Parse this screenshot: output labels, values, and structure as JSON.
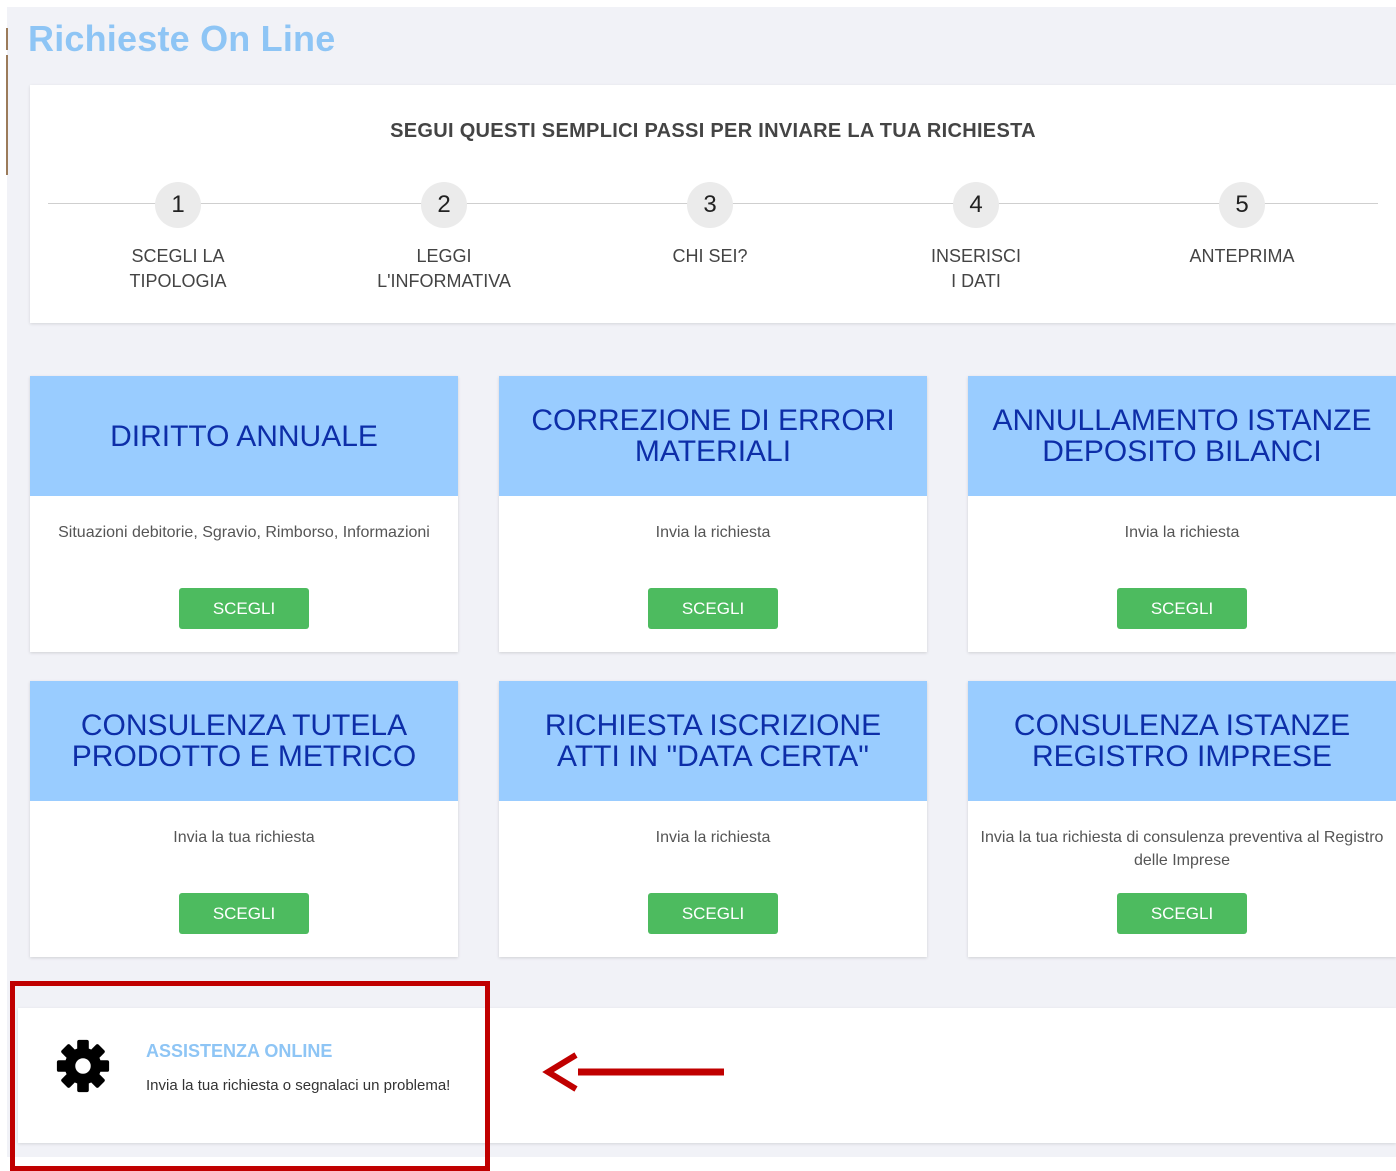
{
  "page": {
    "title": "Richieste On Line"
  },
  "steps": {
    "heading": "SEGUI QUESTI SEMPLICI PASSI PER INVIARE LA TUA RICHIESTA",
    "items": [
      {
        "number": "1",
        "label": "SCEGLI LA\nTIPOLOGIA"
      },
      {
        "number": "2",
        "label": "LEGGI\nL'INFORMATIVA"
      },
      {
        "number": "3",
        "label": "CHI SEI?"
      },
      {
        "number": "4",
        "label": "INSERISCI\nI DATI"
      },
      {
        "number": "5",
        "label": "ANTEPRIMA"
      }
    ]
  },
  "cards": [
    {
      "title": "DIRITTO ANNUALE",
      "description": "Situazioni debitorie, Sgravio, Rimborso, Informazioni",
      "button": "SCEGLI"
    },
    {
      "title": "CORREZIONE DI ERRORI\nMATERIALI",
      "description": "Invia la richiesta",
      "button": "SCEGLI"
    },
    {
      "title": "ANNULLAMENTO ISTANZE\nDEPOSITO BILANCI",
      "description": "Invia la richiesta",
      "button": "SCEGLI"
    },
    {
      "title": "CONSULENZA TUTELA\nPRODOTTO E METRICO",
      "description": "Invia la tua richiesta",
      "button": "SCEGLI"
    },
    {
      "title": "RICHIESTA ISCRIZIONE\nATTI IN \"DATA CERTA\"",
      "description": "Invia la richiesta",
      "button": "SCEGLI"
    },
    {
      "title": "CONSULENZA ISTANZE\nREGISTRO IMPRESE",
      "description": "Invia la tua richiesta di consulenza preventiva al Registro delle Imprese",
      "button": "SCEGLI"
    }
  ],
  "assistance": {
    "title": "ASSISTENZA ONLINE",
    "description": "Invia la tua richiesta o segnalaci un problema!",
    "icon": "gear-icon"
  },
  "colors": {
    "accent_light_blue": "#8ec5f5",
    "card_header_bg": "#99ccff",
    "card_title": "#0d2ea8",
    "button_green": "#4dbb5f",
    "highlight_red": "#c00000"
  }
}
